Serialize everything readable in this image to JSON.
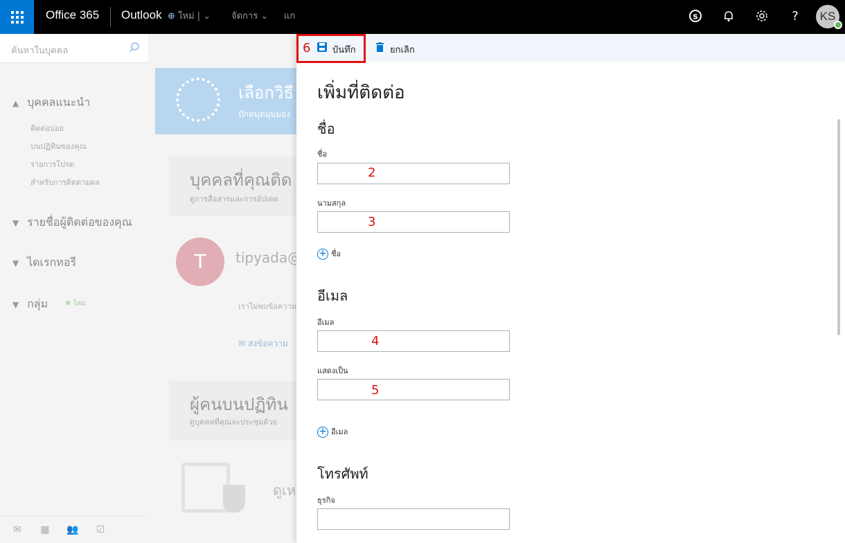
{
  "topbar": {
    "brand": "Office 365",
    "app": "Outlook",
    "user_initials": "KS",
    "icons": [
      "skype-icon",
      "bell-icon",
      "gear-icon",
      "help-icon"
    ]
  },
  "leftnav": {
    "search_placeholder": "ค้นหาในบุคคล",
    "sections": [
      {
        "label": "บุคคลแนะนำ",
        "items": [
          "ติดต่อบ่อย",
          "บนปฏิทินของคุณ",
          "รายการโปรด",
          "สำหรับการติดตามผล"
        ]
      },
      {
        "label": "รายชื่อผู้ติดต่อของคุณ"
      },
      {
        "label": "ไดเรกทอรี"
      },
      {
        "label": "กลุ่ม",
        "badge": "ใหม่"
      }
    ]
  },
  "cmdbar": {
    "new_label": "ใหม่",
    "manage_label": "จัดการ",
    "edit_label": "แก"
  },
  "background": {
    "banner_title": "เลือกวิธี",
    "banner_sub": "ปักหมุดมุมมอง",
    "card1_title": "บุคคลที่คุณติด",
    "card1_sub": "ดูการสื่อสารและการอัปเดต",
    "person_initial": "T",
    "person_name": "tipyada@",
    "person_note": "เราไม่พบข้อความ",
    "person_send": "ส่งข้อความ",
    "card2_title": "ผู้คนบนปฏิทิน",
    "card2_sub": "ดูบุคคลที่คุณจะประชุมด้วย",
    "illu_text": "ดูเห"
  },
  "panel": {
    "step_number": "6",
    "save_label": "บันทึก",
    "discard_label": "ยกเลิก",
    "title": "เพิ่มที่ติดต่อ",
    "name_section": "ชื่อ",
    "first_name_label": "ชื่อ",
    "first_name_step": "2",
    "last_name_label": "นามสกุล",
    "last_name_step": "3",
    "add_name_label": "ชื่อ",
    "email_section": "อีเมล",
    "email_label": "อีเมล",
    "email_step": "4",
    "display_label": "แสดงเป็น",
    "display_step": "5",
    "add_email_label": "อีเมล",
    "phone_section": "โทรศัพท์",
    "business_label": "ธุรกิจ"
  },
  "colors": {
    "accent": "#0078d4",
    "annotation": "#d81010"
  }
}
